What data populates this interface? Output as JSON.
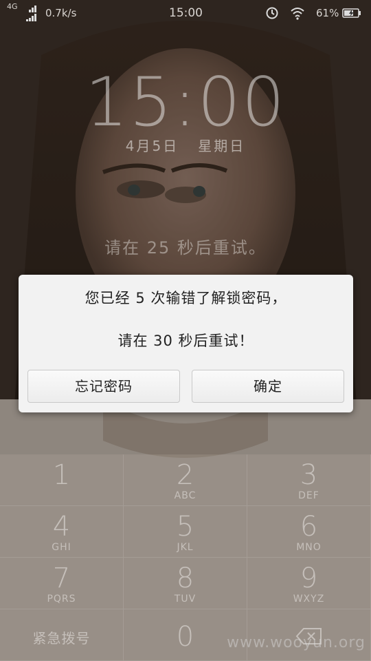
{
  "status_bar": {
    "network": "4G",
    "speed": "0.7k/s",
    "time": "15:00",
    "battery": "61%"
  },
  "lockscreen": {
    "clock": "15:00",
    "date": "4月5日",
    "weekday": "星期日",
    "retry_hint": "请在 25 秒后重试。"
  },
  "dialog": {
    "message_line1": "您已经 5 次输错了解锁密码，",
    "message_line2": "请在 30 秒后重试！",
    "forgot_button": "忘记密码",
    "ok_button": "确定"
  },
  "keypad": {
    "keys": [
      {
        "num": "1",
        "letters": ""
      },
      {
        "num": "2",
        "letters": "ABC"
      },
      {
        "num": "3",
        "letters": "DEF"
      },
      {
        "num": "4",
        "letters": "GHI"
      },
      {
        "num": "5",
        "letters": "JKL"
      },
      {
        "num": "6",
        "letters": "MNO"
      },
      {
        "num": "7",
        "letters": "PQRS"
      },
      {
        "num": "8",
        "letters": "TUV"
      },
      {
        "num": "9",
        "letters": "WXYZ"
      }
    ],
    "emergency": "紧急拨号",
    "zero": "0"
  },
  "watermark": "www.wooyun.org"
}
